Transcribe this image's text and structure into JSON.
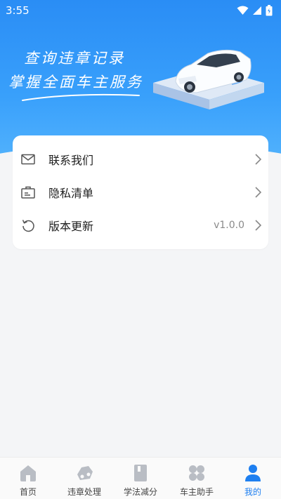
{
  "status_bar": {
    "time": "3:55"
  },
  "banner": {
    "line1": "查询违章记录",
    "line2": "掌握全面车主服务"
  },
  "menu": {
    "items": [
      {
        "label": "联系我们",
        "icon": "mail-icon",
        "value": ""
      },
      {
        "label": "隐私清单",
        "icon": "id-card-icon",
        "value": ""
      },
      {
        "label": "版本更新",
        "icon": "refresh-icon",
        "value": "v1.0.0"
      }
    ]
  },
  "tabbar": {
    "active_color": "#1e7ff0",
    "items": [
      {
        "label": "首页",
        "icon": "home-icon"
      },
      {
        "label": "违章处理",
        "icon": "car-icon"
      },
      {
        "label": "学法减分",
        "icon": "book-icon"
      },
      {
        "label": "车主助手",
        "icon": "grid-icon"
      },
      {
        "label": "我的",
        "icon": "user-icon",
        "active": true
      }
    ]
  }
}
